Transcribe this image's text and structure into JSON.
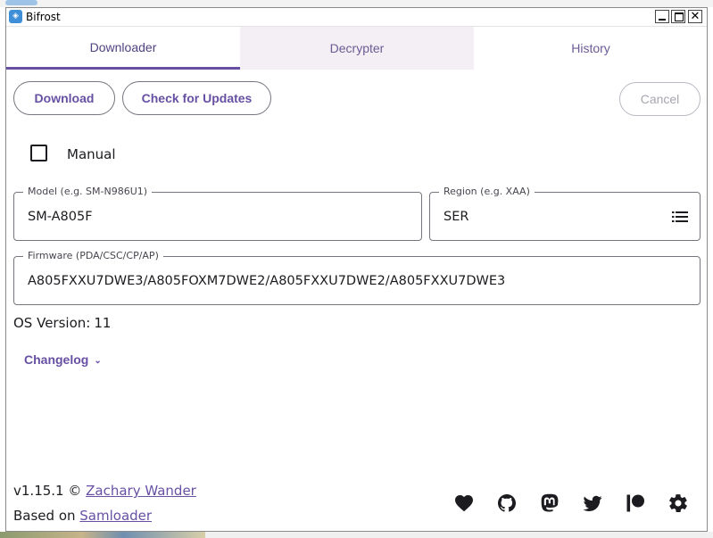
{
  "window": {
    "title": "Bifrost"
  },
  "tabs": [
    {
      "label": "Downloader",
      "active": true
    },
    {
      "label": "Decrypter",
      "active": false
    },
    {
      "label": "History",
      "active": false
    }
  ],
  "actions": {
    "download": "Download",
    "check_updates": "Check for Updates",
    "cancel": "Cancel"
  },
  "manual": {
    "label": "Manual",
    "checked": false
  },
  "model": {
    "label": "Model (e.g. SM-N986U1)",
    "value": "SM-A805F"
  },
  "region": {
    "label": "Region (e.g. XAA)",
    "value": "SER"
  },
  "firmware": {
    "label": "Firmware (PDA/CSC/CP/AP)",
    "value": "A805FXXU7DWE3/A805FOXM7DWE2/A805FXXU7DWE2/A805FXXU7DWE3"
  },
  "os_version": {
    "label": "OS Version:",
    "value": "11"
  },
  "changelog": {
    "label": "Changelog"
  },
  "footer": {
    "version": "v1.15.1 ©",
    "author": "Zachary Wander",
    "based_on": "Based on",
    "samloader": "Samloader"
  },
  "social_icons": [
    "heart-icon",
    "github-icon",
    "mastodon-icon",
    "twitter-icon",
    "patreon-icon",
    "settings-gear-icon"
  ],
  "colors": {
    "accent": "#6750a4",
    "tab_inactive_bg": "#f3eff4"
  }
}
